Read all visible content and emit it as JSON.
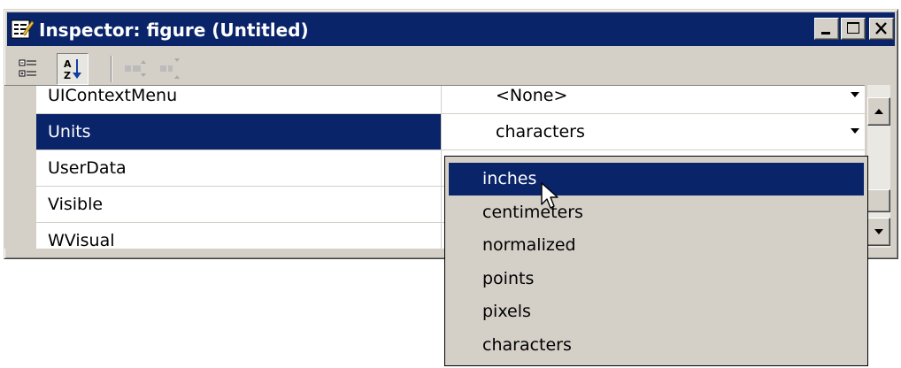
{
  "window": {
    "title": "Inspector:  figure (Untitled)",
    "title_icon": "inspector-icon",
    "buttons": [
      "minimize-icon",
      "maximize-icon",
      "close-icon"
    ]
  },
  "toolbar": {
    "buttons": [
      {
        "icon": "categorized-view-icon",
        "pressed": false
      },
      {
        "icon": "alphabetical-sort-icon",
        "pressed": true
      },
      {
        "icon": "expand-all-icon",
        "pressed": false
      },
      {
        "icon": "collapse-all-icon",
        "pressed": false
      }
    ]
  },
  "properties": [
    {
      "name": "UIContextMenu",
      "value": "<None>"
    },
    {
      "name": "Units",
      "value": "characters"
    },
    {
      "name": "UserData",
      "value": ""
    },
    {
      "name": "Visible",
      "value": ""
    },
    {
      "name": "WVisual",
      "value": ""
    }
  ],
  "selected_property": "Units",
  "dropdown": {
    "options": [
      "inches",
      "centimeters",
      "normalized",
      "points",
      "pixels",
      "characters"
    ],
    "highlighted": "inches"
  },
  "colors": {
    "title_bar": "#0a246a",
    "selection": "#0a246a",
    "face": "#d4d0c8"
  }
}
